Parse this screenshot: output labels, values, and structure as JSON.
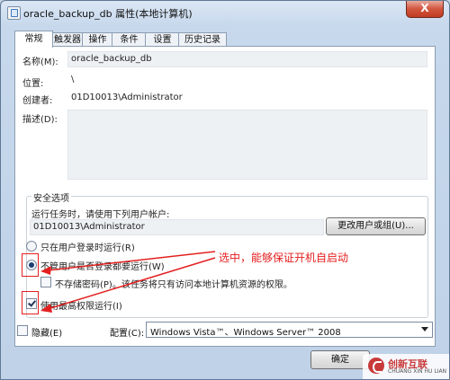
{
  "window": {
    "title": "oracle_backup_db 属性(本地计算机)",
    "close_label": "X"
  },
  "tabs": [
    {
      "label": "常规"
    },
    {
      "label": "触发器"
    },
    {
      "label": "操作"
    },
    {
      "label": "条件"
    },
    {
      "label": "设置"
    },
    {
      "label": "历史记录"
    }
  ],
  "general": {
    "name_label": "名称(M):",
    "name_value": "oracle_backup_db",
    "location_label": "位置:",
    "location_value": "\\",
    "author_label": "创建者:",
    "author_value": "01D10013\\Administrator",
    "description_label": "描述(D):"
  },
  "security": {
    "group_title": "安全选项",
    "run_as_prompt": "运行任务时，请使用下列用户帐户:",
    "user_account": "01D10013\\Administrator",
    "change_user_button": "更改用户或组(U)...",
    "option_logged_on": "只在用户登录时运行(R)",
    "option_whether_logged_on": "不管用户是否登录都要运行(W)",
    "do_not_store_password": "不存储密码(P)。该任务将只有访问本地计算机资源的权限。",
    "highest_privileges": "使用最高权限运行(I)"
  },
  "bottom": {
    "hidden_label": "隐藏(E)",
    "configure_label": "配置(C):",
    "configure_value": "Windows Vista™、Windows Server™ 2008",
    "ok_button": "确定"
  },
  "annotation": {
    "text": "选中，能够保证开机自启动"
  },
  "watermark": {
    "brand": "创新互联",
    "sub": "CHUANG XIN HU LIAN"
  }
}
